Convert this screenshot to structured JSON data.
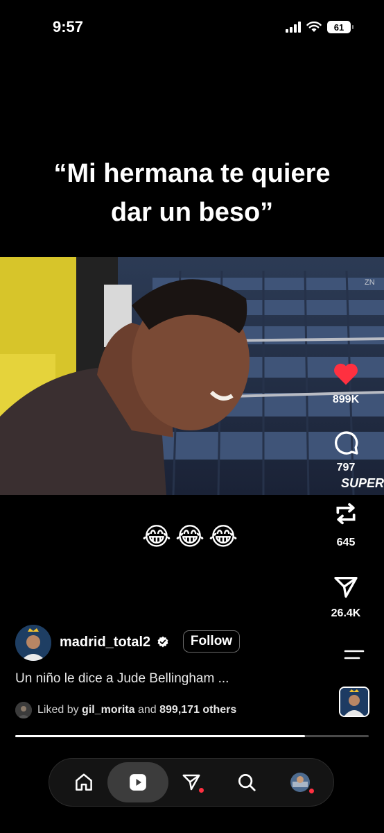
{
  "status": {
    "time": "9:57",
    "battery": "61"
  },
  "overlay": {
    "line1": "“Mi hermana te quiere",
    "line2": "dar un beso”"
  },
  "video": {
    "watermark": "ZN",
    "logo": "SUPER",
    "emojis": "😂😂😂"
  },
  "actions": {
    "like_count": "899K",
    "comment_count": "797",
    "repost_count": "645",
    "share_count": "26.4K"
  },
  "post": {
    "username": "madrid_total2",
    "follow_label": "Follow",
    "caption": "Un niño le dice a Jude Bellingham ...",
    "liked_prefix": "Liked by",
    "liked_user": "gil_morita",
    "liked_and": "and",
    "liked_others": "899,171 others",
    "progress": 0.82
  },
  "nav": [
    "home-icon",
    "reels-icon",
    "messages-icon",
    "search-icon",
    "profile-avatar"
  ],
  "colors": {
    "like": "#ff3040",
    "background": "#000000"
  }
}
